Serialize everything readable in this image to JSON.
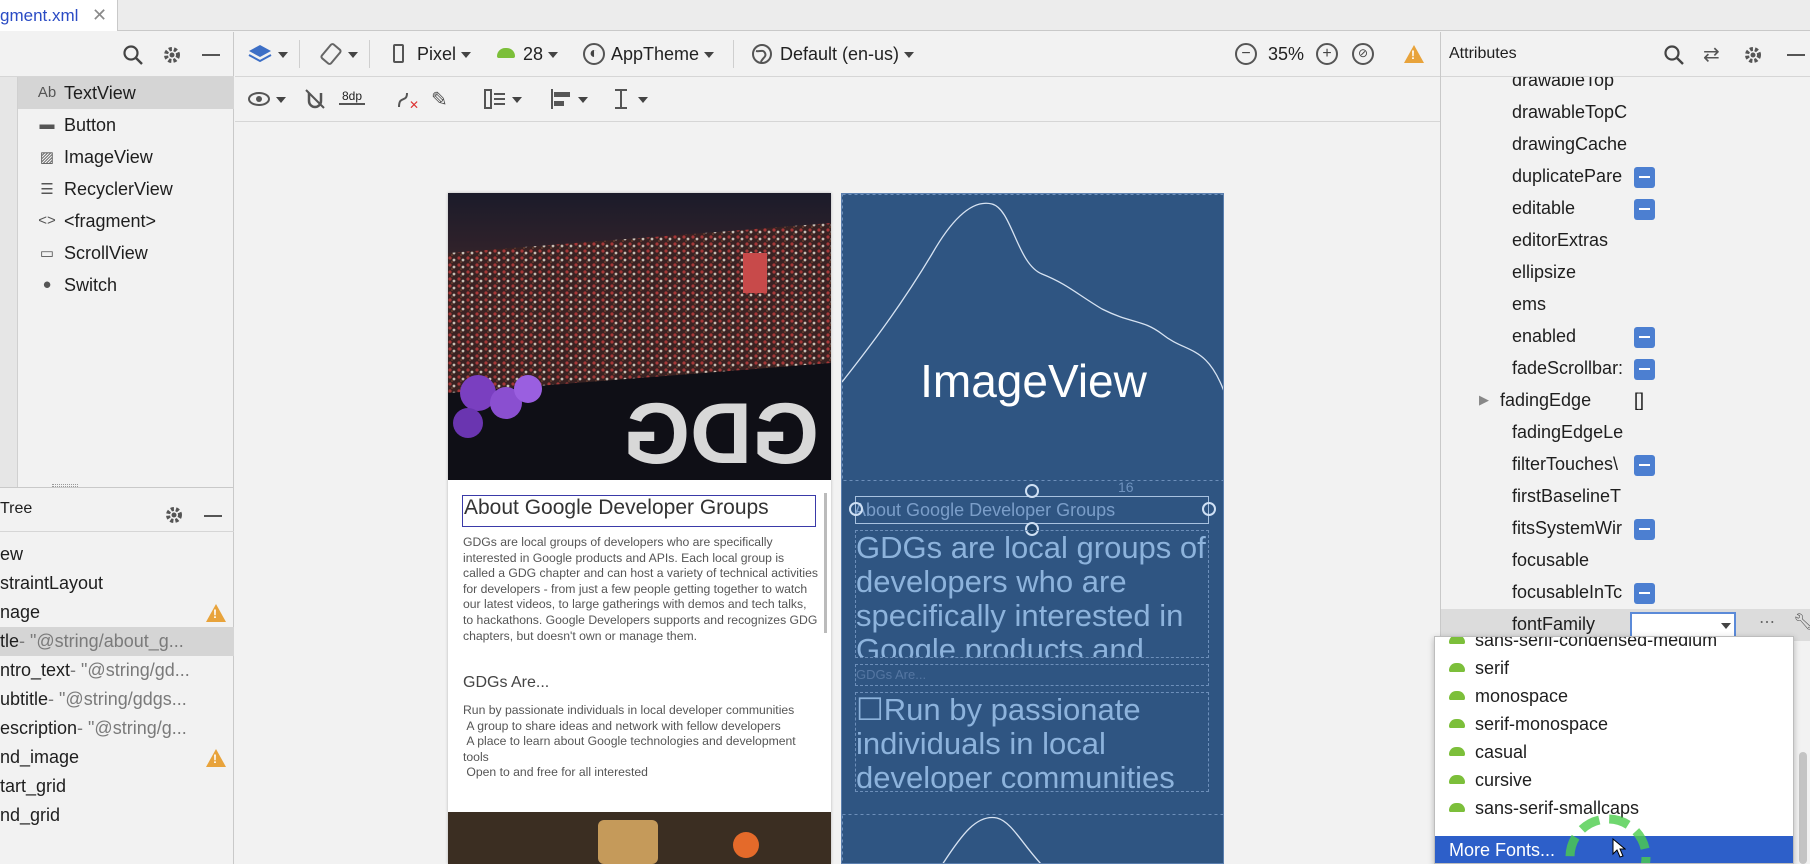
{
  "tab": {
    "title": "gment.xml"
  },
  "palette": {
    "items": [
      {
        "icon": "Ab",
        "label": "TextView"
      },
      {
        "icon": "▬",
        "label": "Button"
      },
      {
        "icon": "▨",
        "label": "ImageView"
      },
      {
        "icon": "☰",
        "label": "RecyclerView"
      },
      {
        "icon": "<>",
        "label": "<fragment>"
      },
      {
        "icon": "▭",
        "label": "ScrollView"
      },
      {
        "icon": "●",
        "label": "Switch"
      }
    ]
  },
  "tree": {
    "title": "Tree",
    "rows": [
      {
        "name": "ew",
        "hint": ""
      },
      {
        "name": "straintLayout",
        "hint": ""
      },
      {
        "name": "nage",
        "hint": ""
      },
      {
        "name": "tle",
        "hint": "- \"@string/about_g..."
      },
      {
        "name": "ntro_text",
        "hint": "- \"@string/gd..."
      },
      {
        "name": "ubtitle",
        "hint": "- \"@string/gdgs..."
      },
      {
        "name": "escription",
        "hint": "- \"@string/g..."
      },
      {
        "name": "nd_image",
        "hint": ""
      },
      {
        "name": "tart_grid",
        "hint": ""
      },
      {
        "name": "nd_grid",
        "hint": ""
      }
    ]
  },
  "toolbar": {
    "device": "Pixel",
    "api": "28",
    "theme": "AppTheme",
    "locale": "Default (en-us)",
    "zoom": "35%",
    "margin": "8dp"
  },
  "design": {
    "title": "About Google Developer Groups",
    "intro": "GDGs are local groups of developers who are specifically interested in Google products and APIs. Each local group is called a GDG chapter and can host a variety of technical activities for developers - from just a few people getting together to watch our latest videos, to large gatherings with demos and tech talks, to hackathons. Google Developers supports and recognizes GDG chapters, but doesn't own or manage them.",
    "subtitle": "GDGs Are...",
    "description": "Run by passionate individuals in local developer communities\n A group to share ideas and network with fellow developers\n A place to learn about Google technologies and development tools\n Open to and free for all interested"
  },
  "blueprint": {
    "image_label": "ImageView",
    "title": "About Google Developer Groups",
    "intro": "GDGs are local groups of developers who are specifically interested in Google products and",
    "subtitle": "GDGs Are...",
    "description": "☐Run by passionate individuals in local developer communities",
    "margin_label": "16"
  },
  "attributes": {
    "title": "Attributes",
    "rows": [
      {
        "name": "drawableTop",
        "flag": false
      },
      {
        "name": "drawableTopC",
        "flag": false
      },
      {
        "name": "drawingCache",
        "flag": false
      },
      {
        "name": "duplicatePare",
        "flag": true
      },
      {
        "name": "editable",
        "flag": true
      },
      {
        "name": "editorExtras",
        "flag": false
      },
      {
        "name": "ellipsize",
        "flag": false
      },
      {
        "name": "ems",
        "flag": false
      },
      {
        "name": "enabled",
        "flag": true
      },
      {
        "name": "fadeScrollbar:",
        "flag": true
      },
      {
        "name": "fadingEdge",
        "flag": false
      },
      {
        "name": "fadingEdgeLe",
        "flag": false
      },
      {
        "name": "filterTouches\\",
        "flag": true
      },
      {
        "name": "firstBaselineT",
        "flag": false
      },
      {
        "name": "fitsSystemWir",
        "flag": true
      },
      {
        "name": "focusable",
        "flag": false
      },
      {
        "name": "focusableInTc",
        "flag": true
      },
      {
        "name": "fontFamily",
        "flag": false
      }
    ],
    "fading_edge_value": "[]",
    "font_family_value": ""
  },
  "font_dropdown": {
    "items": [
      "sans-serif-condensed-medium",
      "serif",
      "monospace",
      "serif-monospace",
      "casual",
      "cursive",
      "sans-serif-smallcaps"
    ],
    "more": "More Fonts..."
  }
}
